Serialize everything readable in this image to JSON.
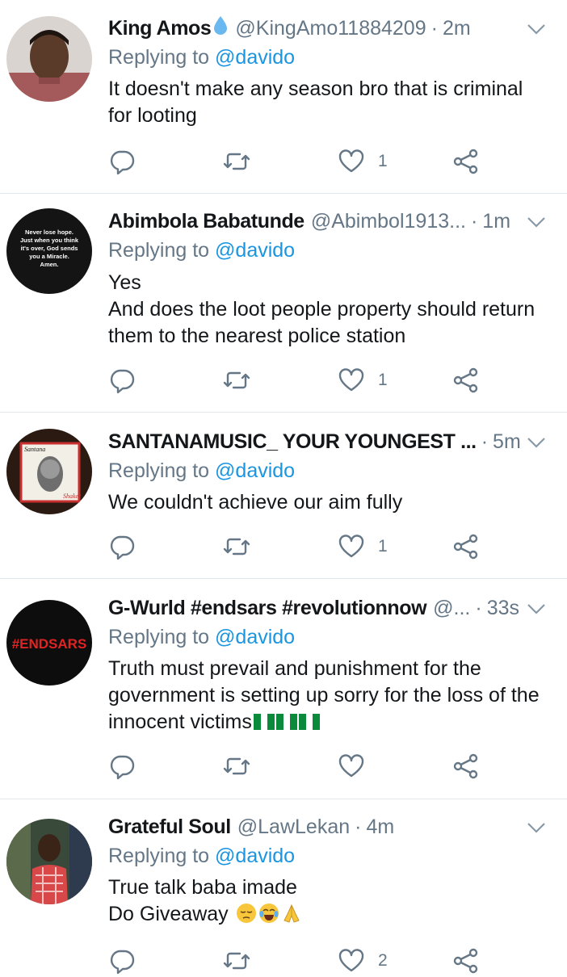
{
  "tweets": [
    {
      "name": "King Amos",
      "has_drop": true,
      "handle": "@KingAmo11884209",
      "time": "2m",
      "replying_prefix": "Replying to",
      "replying_to": "@davido",
      "lines": [
        "It doesn't make any season bro that is criminal",
        "for looting"
      ],
      "like_count": "1",
      "avatar": "person-photo"
    },
    {
      "name": "Abimbola Babatunde",
      "has_drop": false,
      "handle": "@Abimbol1913...",
      "time": "1m",
      "replying_prefix": "Replying to",
      "replying_to": "@davido",
      "lines": [
        "Yes",
        "And does the loot people property should return",
        "them to the nearest police station"
      ],
      "like_count": "1",
      "avatar": "quote-image",
      "avatar_text": [
        "Never lose hope.",
        "Just when you think",
        "it's over, God sends",
        "you a Miracle.",
        "Amen."
      ]
    },
    {
      "name": "SANTANAMUSIC_ YOUR YOUNGEST ...",
      "has_drop": false,
      "handle": "",
      "time": "5m",
      "replying_prefix": "Replying to",
      "replying_to": "@davido",
      "lines": [
        "We couldn't achieve our aim fully"
      ],
      "like_count": "1",
      "avatar": "album-cover",
      "avatar_text": [
        "Santana",
        "Shaker"
      ]
    },
    {
      "name": "G-Wurld #endsars #revolutionnow",
      "has_drop": false,
      "handle": "@...",
      "time": "33s",
      "replying_prefix": "Replying to",
      "replying_to": "@davido",
      "lines": [
        "Truth must prevail and punishment for the",
        "government is setting up sorry for the loss of the",
        "innocent victims"
      ],
      "like_count": "",
      "avatar": "endsars-logo",
      "avatar_text": [
        "#ENDSARS"
      ]
    },
    {
      "name": "Grateful Soul",
      "has_drop": false,
      "handle": "@LawLekan",
      "time": "4m",
      "replying_prefix": "Replying to",
      "replying_to": "@davido",
      "lines": [
        "True talk baba imade",
        "Do Giveaway"
      ],
      "like_count": "2",
      "avatar": "person-photo"
    }
  ],
  "colors": {
    "link": "#1b95e0",
    "meta": "#657786",
    "text": "#14171a",
    "divider": "#e1e8ed"
  },
  "icons": [
    "reply-icon",
    "retweet-icon",
    "like-icon",
    "share-icon",
    "chevron-down-icon",
    "water-drop-icon"
  ]
}
